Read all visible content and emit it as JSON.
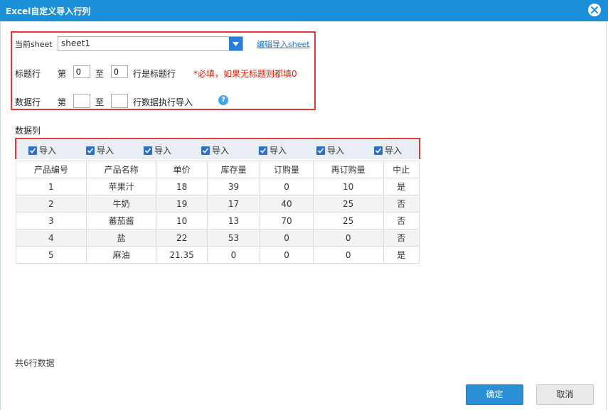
{
  "dialog": {
    "title": "Excel自定义导入行列"
  },
  "sheet_row": {
    "label": "当前sheet",
    "selected": "sheet1",
    "edit_link": "编辑导入sheet"
  },
  "header_row": {
    "label": "标题行",
    "prefix": "第",
    "from": "0",
    "mid": "至",
    "to": "0",
    "suffix": "行是标题行",
    "required_note": "*必填，如果无标题则都填0"
  },
  "data_row": {
    "label": "数据行",
    "prefix": "第",
    "from": "",
    "mid": "至",
    "to": "",
    "suffix": "行数据执行导入",
    "help_glyph": "?"
  },
  "columns_section": {
    "label": "数据列",
    "import_label": "导入",
    "checked": [
      true,
      true,
      true,
      true,
      true,
      true,
      true
    ]
  },
  "table": {
    "headers": [
      "产品编号",
      "产品名称",
      "单价",
      "库存量",
      "订购量",
      "再订购量",
      "中止"
    ],
    "rows": [
      [
        "1",
        "苹果汁",
        "18",
        "39",
        "0",
        "10",
        "是"
      ],
      [
        "2",
        "牛奶",
        "19",
        "17",
        "40",
        "25",
        "否"
      ],
      [
        "3",
        "蕃茄酱",
        "10",
        "13",
        "70",
        "25",
        "否"
      ],
      [
        "4",
        "盐",
        "22",
        "53",
        "0",
        "0",
        "否"
      ],
      [
        "5",
        "麻油",
        "21.35",
        "0",
        "0",
        "0",
        "是"
      ]
    ]
  },
  "footer": {
    "count": "共6行数据",
    "ok_label": "确定",
    "cancel_label": "取消"
  },
  "colors": {
    "titlebar": "#1b8fd8",
    "highlight": "#e03a3a",
    "required": "#d81e06",
    "primary_button": "#2b8fd8"
  }
}
